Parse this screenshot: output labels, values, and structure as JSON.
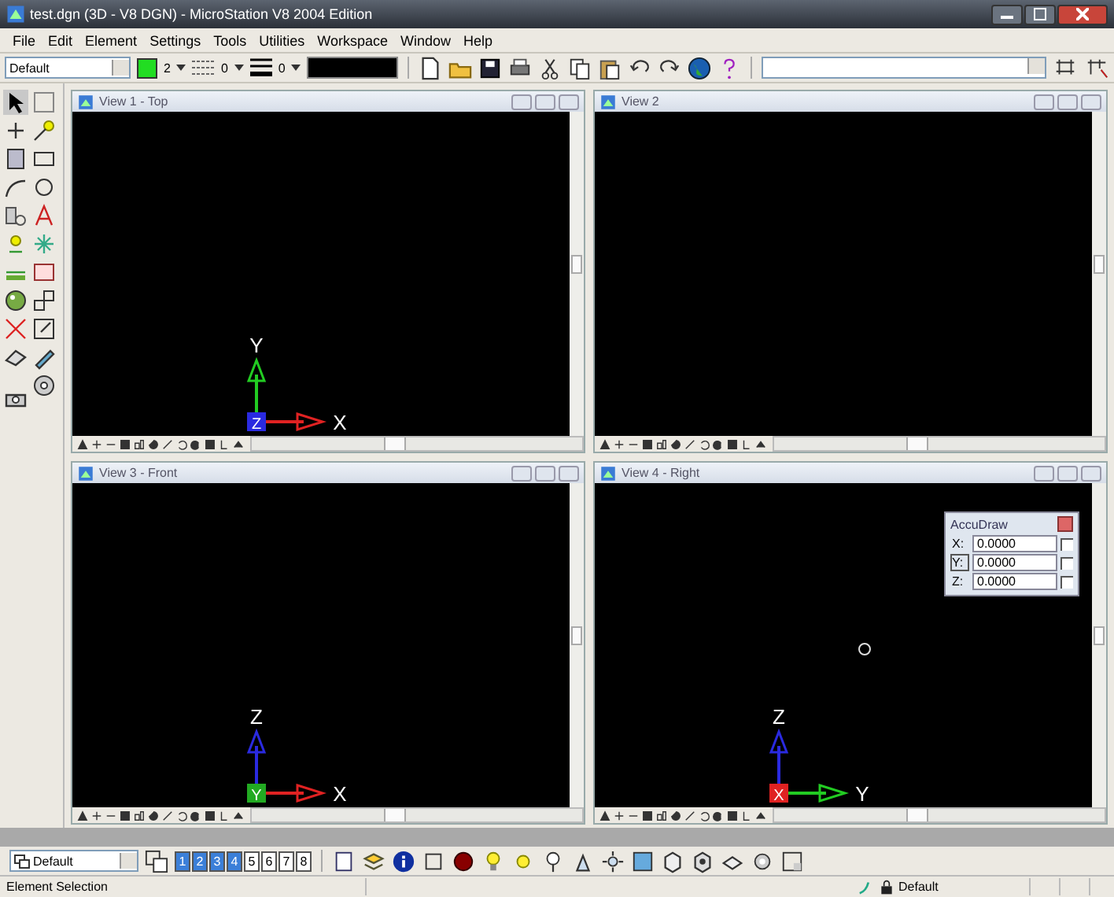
{
  "window": {
    "title": "test.dgn (3D - V8 DGN) - MicroStation V8 2004 Edition"
  },
  "menu": [
    "File",
    "Edit",
    "Element",
    "Settings",
    "Tools",
    "Utilities",
    "Workspace",
    "Window",
    "Help"
  ],
  "attributes": {
    "level": "Default",
    "color": "#22dd22",
    "color_index": "2",
    "style": "0",
    "weight": "0"
  },
  "views": [
    {
      "title": "View 1 - Top",
      "origin": {
        "label": "Z",
        "color": "#2a2ae0"
      },
      "axes": [
        {
          "kind": "up",
          "label": "Y",
          "color": "#22cc22"
        },
        {
          "kind": "right",
          "label": "X",
          "color": "#e02222"
        }
      ]
    },
    {
      "title": "View 2"
    },
    {
      "title": "View 3 - Front",
      "origin": {
        "label": "Y",
        "color": "#22aa22"
      },
      "axes": [
        {
          "kind": "up",
          "label": "Z",
          "color": "#2a2ae0"
        },
        {
          "kind": "right",
          "label": "X",
          "color": "#e02222"
        }
      ]
    },
    {
      "title": "View 4 - Right",
      "origin": {
        "label": "X",
        "color": "#e02222"
      },
      "axes": [
        {
          "kind": "up",
          "label": "Z",
          "color": "#2a2ae0"
        },
        {
          "kind": "right",
          "label": "Y",
          "color": "#22cc22"
        }
      ],
      "cursor": true,
      "accudraw": {
        "title": "AccuDraw",
        "rows": [
          {
            "label": "X:",
            "value": "0.0000",
            "focused": false,
            "locked": false
          },
          {
            "label": "Y:",
            "value": "0.0000",
            "focused": true,
            "locked": false
          },
          {
            "label": "Z:",
            "value": "0.0000",
            "focused": false,
            "locked": false
          }
        ]
      }
    }
  ],
  "view_bar": {
    "view_group": "Default",
    "view_buttons": [
      {
        "label": "1",
        "selected": true
      },
      {
        "label": "2",
        "selected": true
      },
      {
        "label": "3",
        "selected": true
      },
      {
        "label": "4",
        "selected": true
      },
      {
        "label": "5",
        "selected": false
      },
      {
        "label": "6",
        "selected": false
      },
      {
        "label": "7",
        "selected": false
      },
      {
        "label": "8",
        "selected": false
      }
    ]
  },
  "status_bar": {
    "message": "Element Selection",
    "level": "Default"
  }
}
